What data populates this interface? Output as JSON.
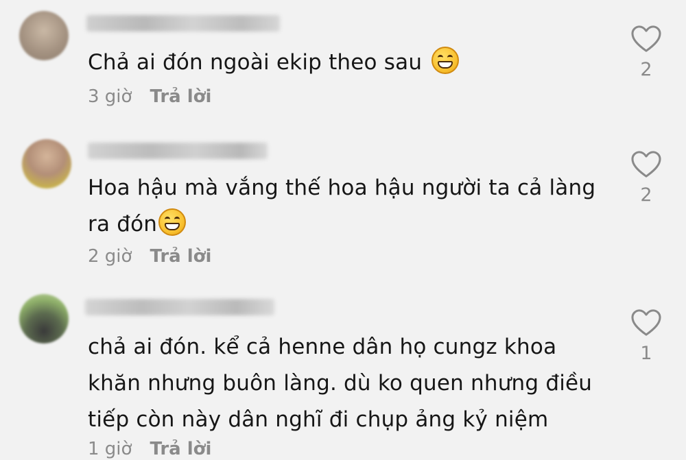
{
  "comments": [
    {
      "text_lines": [
        "Chả ai đón ngoài ekip theo sau"
      ],
      "emoji": "grinning-face-emoji",
      "time": "3 giờ",
      "reply_label": "Trả lời",
      "likes": "2"
    },
    {
      "text_lines": [
        "Hoa hậu mà vắng thế hoa hậu người ta cả làng",
        "ra đón"
      ],
      "emoji": "grinning-face-emoji",
      "time": "2 giờ",
      "reply_label": "Trả lời",
      "likes": "2"
    },
    {
      "text_lines": [
        "chả ai đón. kể cả henne dân họ cungz khoa",
        "khăn nhưng buôn làng. dù ko quen nhưng điều",
        "tiếp còn này dân nghĩ đi chụp ảng kỷ niệm"
      ],
      "time": "1 giờ",
      "reply_label": "Trả lời",
      "likes": "1"
    }
  ],
  "colors": {
    "background": "#f2f2f2",
    "text": "#161616",
    "muted": "#8a8a8a"
  },
  "icons": {
    "like": "heart-outline-icon"
  }
}
